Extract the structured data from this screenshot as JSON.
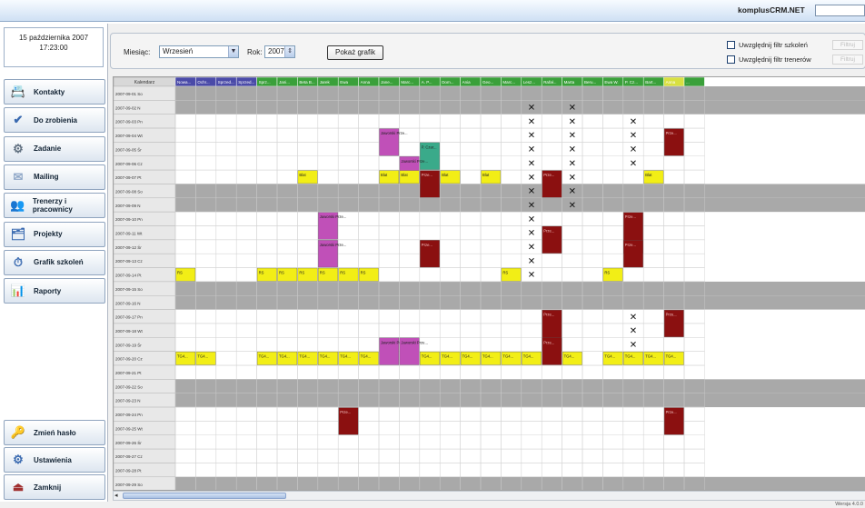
{
  "window": {
    "brand": "komplusCRM.NET"
  },
  "sidebar": {
    "date_line1": "15 października 2007",
    "date_line2": "17:23:00",
    "buttons": [
      {
        "label": "Kontakty",
        "icon": "contacts-icon"
      },
      {
        "label": "Do zrobienia",
        "icon": "todo-icon"
      },
      {
        "label": "Zadanie",
        "icon": "task-icon"
      },
      {
        "label": "Mailing",
        "icon": "mail-icon"
      },
      {
        "label": "Trenerzy i pracownicy",
        "icon": "trainers-icon"
      },
      {
        "label": "Projekty",
        "icon": "projects-icon"
      },
      {
        "label": "Grafik szkoleń",
        "icon": "schedule-icon"
      },
      {
        "label": "Raporty",
        "icon": "reports-icon"
      }
    ],
    "bottom_buttons": [
      {
        "label": "Zmień hasło",
        "icon": "key-icon"
      },
      {
        "label": "Ustawienia",
        "icon": "settings-icon"
      },
      {
        "label": "Zamknij",
        "icon": "exit-icon"
      }
    ]
  },
  "toolbar": {
    "month_label": "Miesiąc:",
    "month_value": "Wrzesień",
    "year_label": "Rok:",
    "year_value": "2007",
    "show_button": "Pokaż grafik",
    "check1_label": "Uwzględnij filtr szkoleń",
    "check2_label": "Uwzględnij filtr trenerów",
    "filter_button": "Filtruj"
  },
  "grid": {
    "header_first": "Kalendarz",
    "dates": [
      "2007-09-01 So",
      "2007-09-02 N",
      "2007-09-03 Pn",
      "2007-09-04 Wt",
      "2007-09-05 Śr",
      "2007-09-06 Cz",
      "2007-09-07 Pt",
      "2007-09-08 So",
      "2007-09-09 N",
      "2007-09-10 Pn",
      "2007-09-11 Wt",
      "2007-09-12 Śr",
      "2007-09-13 Cz",
      "2007-09-14 Pt",
      "2007-09-15 So",
      "2007-09-16 N",
      "2007-09-17 Pn",
      "2007-09-18 Wt",
      "2007-09-19 Śr",
      "2007-09-20 Cz",
      "2007-09-21 Pt",
      "2007-09-22 So",
      "2007-09-23 N",
      "2007-09-24 Pn",
      "2007-09-25 Wt",
      "2007-09-26 Śr",
      "2007-09-27 Cz",
      "2007-09-28 Pt",
      "2007-09-29 So"
    ],
    "columns": [
      {
        "label": "Nowa...",
        "color": "#4a4aa8"
      },
      {
        "label": "Ochr...",
        "color": "#4a4aa8"
      },
      {
        "label": "Sprzed...",
        "color": "#4a4aa8"
      },
      {
        "label": "Sprzed...",
        "color": "#4a4aa8"
      },
      {
        "label": "Sprz...",
        "color": "#3aa03a"
      },
      {
        "label": "Jani...",
        "color": "#3aa03a"
      },
      {
        "label": "Beta B...",
        "color": "#3aa03a"
      },
      {
        "label": "Jarek",
        "color": "#3aa03a"
      },
      {
        "label": "Ewa",
        "color": "#3aa03a"
      },
      {
        "label": "Anna",
        "color": "#3aa03a"
      },
      {
        "label": "Jane...",
        "color": "#3aa03a"
      },
      {
        "label": "Marc...",
        "color": "#3aa03a"
      },
      {
        "label": "A. P...",
        "color": "#3aa03a"
      },
      {
        "label": "Dom...",
        "color": "#3aa03a"
      },
      {
        "label": "Ania",
        "color": "#3aa03a"
      },
      {
        "label": "Geo...",
        "color": "#3aa03a"
      },
      {
        "label": "Marc...",
        "color": "#3aa03a"
      },
      {
        "label": "Lesz...",
        "color": "#3aa03a"
      },
      {
        "label": "Rafał...",
        "color": "#3aa03a"
      },
      {
        "label": "Marta",
        "color": "#3aa03a"
      },
      {
        "label": "Beru...",
        "color": "#3aa03a"
      },
      {
        "label": "Ewa W.",
        "color": "#3aa03a"
      },
      {
        "label": "P. Cz...",
        "color": "#3aa03a"
      },
      {
        "label": "Bart...",
        "color": "#3aa03a"
      },
      {
        "label": "Anna",
        "color": "#d8e040"
      },
      {
        "label": "...",
        "color": "#3aa03a"
      }
    ],
    "colors": {
      "weekend": "#a9a9a9",
      "yellow": "#f2ee16",
      "magenta": "#c050b8",
      "darkred": "#8b1010",
      "teal": "#3aaa8a",
      "date_bg": "#e8e8e8"
    },
    "events": [
      {
        "row": 3,
        "col": 10,
        "span": 2,
        "type": "magenta",
        "text": "Jaworski Prze..."
      },
      {
        "row": 3,
        "col": 24,
        "span": 2,
        "type": "darkred",
        "text": "Prze..."
      },
      {
        "row": 4,
        "col": 12,
        "span": 2,
        "type": "teal",
        "text": "P. Czar..."
      },
      {
        "row": 5,
        "col": 11,
        "span": 2,
        "type": "magenta",
        "text": "Jaworski Prze..."
      },
      {
        "row": 6,
        "col": 12,
        "span": 2,
        "type": "darkred",
        "text": "Prze..."
      },
      {
        "row": 6,
        "col": 18,
        "span": 2,
        "type": "darkred",
        "text": "Prze..."
      },
      {
        "row": 6,
        "col": 6,
        "span": 1,
        "type": "yellow",
        "text": "Blat"
      },
      {
        "row": 6,
        "col": 10,
        "span": 1,
        "type": "yellow",
        "text": "Blat"
      },
      {
        "row": 6,
        "col": 11,
        "span": 1,
        "type": "yellow",
        "text": "Blat"
      },
      {
        "row": 6,
        "col": 13,
        "span": 1,
        "type": "yellow",
        "text": "Blat"
      },
      {
        "row": 6,
        "col": 15,
        "span": 1,
        "type": "yellow",
        "text": "Blat"
      },
      {
        "row": 6,
        "col": 23,
        "span": 1,
        "type": "yellow",
        "text": "Blat"
      },
      {
        "row": 9,
        "col": 7,
        "span": 2,
        "type": "magenta",
        "text": "Jaworski Prze..."
      },
      {
        "row": 9,
        "col": 22,
        "span": 3,
        "type": "darkred",
        "text": "Prze..."
      },
      {
        "row": 10,
        "col": 18,
        "span": 2,
        "type": "darkred",
        "text": "Prze..."
      },
      {
        "row": 11,
        "col": 12,
        "span": 2,
        "type": "darkred",
        "text": "Prze..."
      },
      {
        "row": 11,
        "col": 7,
        "span": 2,
        "type": "magenta",
        "text": "Jaworski Prze..."
      },
      {
        "row": 11,
        "col": 22,
        "span": 2,
        "type": "darkred",
        "text": "Prze..."
      },
      {
        "row": 13,
        "col": 0,
        "span": 1,
        "type": "yellow",
        "text": "RS"
      },
      {
        "row": 13,
        "col": 4,
        "span": 1,
        "type": "yellow",
        "text": "RS"
      },
      {
        "row": 13,
        "col": 5,
        "span": 1,
        "type": "yellow",
        "text": "RS"
      },
      {
        "row": 13,
        "col": 6,
        "span": 1,
        "type": "yellow",
        "text": "RS"
      },
      {
        "row": 13,
        "col": 7,
        "span": 1,
        "type": "yellow",
        "text": "RS"
      },
      {
        "row": 13,
        "col": 8,
        "span": 1,
        "type": "yellow",
        "text": "RS"
      },
      {
        "row": 13,
        "col": 9,
        "span": 1,
        "type": "yellow",
        "text": "RS"
      },
      {
        "row": 13,
        "col": 16,
        "span": 1,
        "type": "yellow",
        "text": "RS"
      },
      {
        "row": 13,
        "col": 21,
        "span": 1,
        "type": "yellow",
        "text": "RS"
      },
      {
        "row": 16,
        "col": 18,
        "span": 3,
        "type": "darkred",
        "text": "Prze..."
      },
      {
        "row": 16,
        "col": 24,
        "span": 2,
        "type": "darkred",
        "text": "Prze..."
      },
      {
        "row": 18,
        "col": 10,
        "span": 2,
        "type": "magenta",
        "text": "Jaworski Prze..."
      },
      {
        "row": 18,
        "col": 11,
        "span": 2,
        "type": "magenta",
        "text": "Jaworski Prze..."
      },
      {
        "row": 18,
        "col": 18,
        "span": 2,
        "type": "darkred",
        "text": "Prze..."
      },
      {
        "row": 19,
        "col": 0,
        "span": 1,
        "type": "yellow",
        "text": "TG4..."
      },
      {
        "row": 19,
        "col": 1,
        "span": 1,
        "type": "yellow",
        "text": "TG4..."
      },
      {
        "row": 19,
        "col": 4,
        "span": 1,
        "type": "yellow",
        "text": "TG4..."
      },
      {
        "row": 19,
        "col": 5,
        "span": 1,
        "type": "yellow",
        "text": "TG4..."
      },
      {
        "row": 19,
        "col": 6,
        "span": 1,
        "type": "yellow",
        "text": "TG4..."
      },
      {
        "row": 19,
        "col": 7,
        "span": 1,
        "type": "yellow",
        "text": "TG4..."
      },
      {
        "row": 19,
        "col": 8,
        "span": 1,
        "type": "yellow",
        "text": "TG4..."
      },
      {
        "row": 19,
        "col": 9,
        "span": 1,
        "type": "yellow",
        "text": "TG4..."
      },
      {
        "row": 19,
        "col": 12,
        "span": 1,
        "type": "yellow",
        "text": "TG4..."
      },
      {
        "row": 19,
        "col": 13,
        "span": 1,
        "type": "yellow",
        "text": "TG4..."
      },
      {
        "row": 19,
        "col": 14,
        "span": 1,
        "type": "yellow",
        "text": "TG4..."
      },
      {
        "row": 19,
        "col": 15,
        "span": 1,
        "type": "yellow",
        "text": "TG4..."
      },
      {
        "row": 19,
        "col": 16,
        "span": 1,
        "type": "yellow",
        "text": "TG4..."
      },
      {
        "row": 19,
        "col": 17,
        "span": 1,
        "type": "yellow",
        "text": "TG4..."
      },
      {
        "row": 19,
        "col": 19,
        "span": 1,
        "type": "yellow",
        "text": "TG4..."
      },
      {
        "row": 19,
        "col": 21,
        "span": 1,
        "type": "yellow",
        "text": "TG4..."
      },
      {
        "row": 19,
        "col": 22,
        "span": 1,
        "type": "yellow",
        "text": "TG4..."
      },
      {
        "row": 19,
        "col": 23,
        "span": 1,
        "type": "yellow",
        "text": "TG4..."
      },
      {
        "row": 19,
        "col": 24,
        "span": 1,
        "type": "yellow",
        "text": "TG4..."
      },
      {
        "row": 23,
        "col": 8,
        "span": 2,
        "type": "darkred",
        "text": "Prze..."
      },
      {
        "row": 23,
        "col": 24,
        "span": 2,
        "type": "darkred",
        "text": "Prze..."
      }
    ],
    "x_marks": [
      {
        "col": 17,
        "rows": [
          1,
          2,
          3,
          4,
          5,
          6,
          7,
          8,
          9,
          10,
          11,
          12,
          13
        ]
      },
      {
        "col": 19,
        "rows": [
          1,
          2,
          3,
          4,
          5,
          6,
          7,
          8
        ]
      },
      {
        "col": 22,
        "rows": [
          2,
          3,
          4,
          5,
          16,
          17,
          18
        ]
      }
    ]
  },
  "status": {
    "version": "Wersja 4.0.0"
  }
}
